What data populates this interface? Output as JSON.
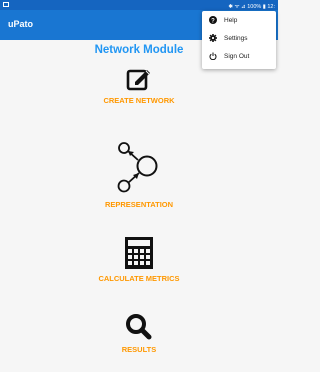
{
  "status_bar": {
    "right_text": "✱ ᯤ ⊿ 100% ▮ 12:"
  },
  "app_bar": {
    "title": "uPato"
  },
  "page": {
    "module_title": "Network Module"
  },
  "actions": [
    {
      "label": "CREATE NETWORK",
      "icon": "edit-icon"
    },
    {
      "label": "REPRESENTATION",
      "icon": "network-graph-icon"
    },
    {
      "label": "CALCULATE METRICS",
      "icon": "calculator-icon"
    },
    {
      "label": "RESULTS",
      "icon": "search-icon"
    }
  ],
  "overflow_menu": {
    "items": [
      {
        "label": "Help",
        "icon": "help-icon"
      },
      {
        "label": "Settings",
        "icon": "gear-icon"
      },
      {
        "label": "Sign Out",
        "icon": "power-icon"
      }
    ]
  },
  "colors": {
    "primary": "#1976d2",
    "status": "#1565c0",
    "accent": "#ff9800",
    "title": "#2196f3"
  }
}
